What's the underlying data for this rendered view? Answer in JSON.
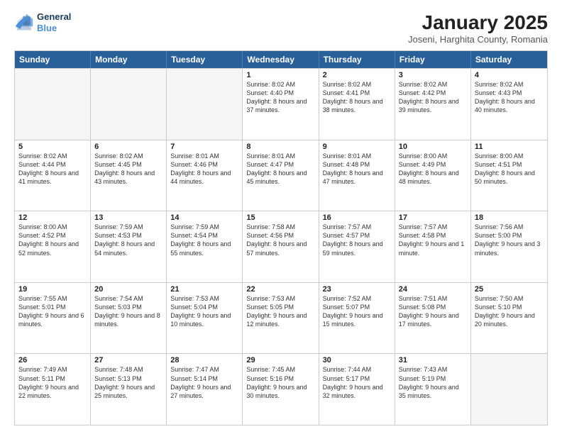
{
  "header": {
    "logo_line1": "General",
    "logo_line2": "Blue",
    "month_year": "January 2025",
    "location": "Joseni, Harghita County, Romania"
  },
  "days_of_week": [
    "Sunday",
    "Monday",
    "Tuesday",
    "Wednesday",
    "Thursday",
    "Friday",
    "Saturday"
  ],
  "weeks": [
    [
      {
        "day": "",
        "text": "",
        "empty": true
      },
      {
        "day": "",
        "text": "",
        "empty": true
      },
      {
        "day": "",
        "text": "",
        "empty": true
      },
      {
        "day": "1",
        "text": "Sunrise: 8:02 AM\nSunset: 4:40 PM\nDaylight: 8 hours and 37 minutes."
      },
      {
        "day": "2",
        "text": "Sunrise: 8:02 AM\nSunset: 4:41 PM\nDaylight: 8 hours and 38 minutes."
      },
      {
        "day": "3",
        "text": "Sunrise: 8:02 AM\nSunset: 4:42 PM\nDaylight: 8 hours and 39 minutes."
      },
      {
        "day": "4",
        "text": "Sunrise: 8:02 AM\nSunset: 4:43 PM\nDaylight: 8 hours and 40 minutes."
      }
    ],
    [
      {
        "day": "5",
        "text": "Sunrise: 8:02 AM\nSunset: 4:44 PM\nDaylight: 8 hours and 41 minutes."
      },
      {
        "day": "6",
        "text": "Sunrise: 8:02 AM\nSunset: 4:45 PM\nDaylight: 8 hours and 43 minutes."
      },
      {
        "day": "7",
        "text": "Sunrise: 8:01 AM\nSunset: 4:46 PM\nDaylight: 8 hours and 44 minutes."
      },
      {
        "day": "8",
        "text": "Sunrise: 8:01 AM\nSunset: 4:47 PM\nDaylight: 8 hours and 45 minutes."
      },
      {
        "day": "9",
        "text": "Sunrise: 8:01 AM\nSunset: 4:48 PM\nDaylight: 8 hours and 47 minutes."
      },
      {
        "day": "10",
        "text": "Sunrise: 8:00 AM\nSunset: 4:49 PM\nDaylight: 8 hours and 48 minutes."
      },
      {
        "day": "11",
        "text": "Sunrise: 8:00 AM\nSunset: 4:51 PM\nDaylight: 8 hours and 50 minutes."
      }
    ],
    [
      {
        "day": "12",
        "text": "Sunrise: 8:00 AM\nSunset: 4:52 PM\nDaylight: 8 hours and 52 minutes."
      },
      {
        "day": "13",
        "text": "Sunrise: 7:59 AM\nSunset: 4:53 PM\nDaylight: 8 hours and 54 minutes."
      },
      {
        "day": "14",
        "text": "Sunrise: 7:59 AM\nSunset: 4:54 PM\nDaylight: 8 hours and 55 minutes."
      },
      {
        "day": "15",
        "text": "Sunrise: 7:58 AM\nSunset: 4:56 PM\nDaylight: 8 hours and 57 minutes."
      },
      {
        "day": "16",
        "text": "Sunrise: 7:57 AM\nSunset: 4:57 PM\nDaylight: 8 hours and 59 minutes."
      },
      {
        "day": "17",
        "text": "Sunrise: 7:57 AM\nSunset: 4:58 PM\nDaylight: 9 hours and 1 minute."
      },
      {
        "day": "18",
        "text": "Sunrise: 7:56 AM\nSunset: 5:00 PM\nDaylight: 9 hours and 3 minutes."
      }
    ],
    [
      {
        "day": "19",
        "text": "Sunrise: 7:55 AM\nSunset: 5:01 PM\nDaylight: 9 hours and 6 minutes."
      },
      {
        "day": "20",
        "text": "Sunrise: 7:54 AM\nSunset: 5:03 PM\nDaylight: 9 hours and 8 minutes."
      },
      {
        "day": "21",
        "text": "Sunrise: 7:53 AM\nSunset: 5:04 PM\nDaylight: 9 hours and 10 minutes."
      },
      {
        "day": "22",
        "text": "Sunrise: 7:53 AM\nSunset: 5:05 PM\nDaylight: 9 hours and 12 minutes."
      },
      {
        "day": "23",
        "text": "Sunrise: 7:52 AM\nSunset: 5:07 PM\nDaylight: 9 hours and 15 minutes."
      },
      {
        "day": "24",
        "text": "Sunrise: 7:51 AM\nSunset: 5:08 PM\nDaylight: 9 hours and 17 minutes."
      },
      {
        "day": "25",
        "text": "Sunrise: 7:50 AM\nSunset: 5:10 PM\nDaylight: 9 hours and 20 minutes."
      }
    ],
    [
      {
        "day": "26",
        "text": "Sunrise: 7:49 AM\nSunset: 5:11 PM\nDaylight: 9 hours and 22 minutes."
      },
      {
        "day": "27",
        "text": "Sunrise: 7:48 AM\nSunset: 5:13 PM\nDaylight: 9 hours and 25 minutes."
      },
      {
        "day": "28",
        "text": "Sunrise: 7:47 AM\nSunset: 5:14 PM\nDaylight: 9 hours and 27 minutes."
      },
      {
        "day": "29",
        "text": "Sunrise: 7:45 AM\nSunset: 5:16 PM\nDaylight: 9 hours and 30 minutes."
      },
      {
        "day": "30",
        "text": "Sunrise: 7:44 AM\nSunset: 5:17 PM\nDaylight: 9 hours and 32 minutes."
      },
      {
        "day": "31",
        "text": "Sunrise: 7:43 AM\nSunset: 5:19 PM\nDaylight: 9 hours and 35 minutes."
      },
      {
        "day": "",
        "text": "",
        "empty": true
      }
    ]
  ]
}
